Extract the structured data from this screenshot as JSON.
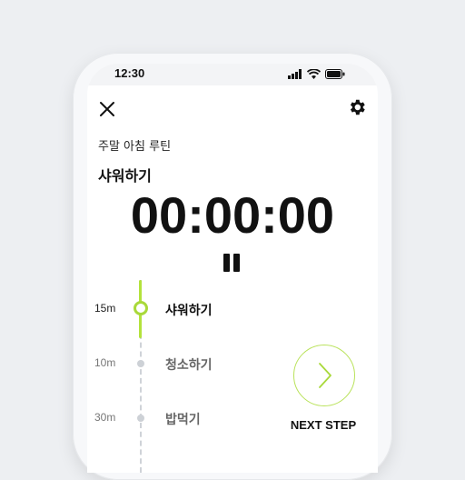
{
  "status_bar": {
    "time": "12:30",
    "icons": [
      "signal-icon",
      "wifi-icon",
      "battery-icon"
    ]
  },
  "header": {
    "close_icon": "close-icon",
    "settings_icon": "gear-icon"
  },
  "routine": {
    "name": "주말 아침 루틴",
    "current_step": "샤워하기",
    "timer": "00:00:00",
    "pause_icon": "pause-icon"
  },
  "steps": [
    {
      "duration": "15m",
      "label": "샤워하기",
      "active": true
    },
    {
      "duration": "10m",
      "label": "청소하기",
      "active": false
    },
    {
      "duration": "30m",
      "label": "밥먹기",
      "active": false
    }
  ],
  "next": {
    "label": "NEXT STEP",
    "icon": "chevron-right-icon"
  },
  "colors": {
    "accent": "#a9d93a",
    "background": "#edeff2"
  }
}
